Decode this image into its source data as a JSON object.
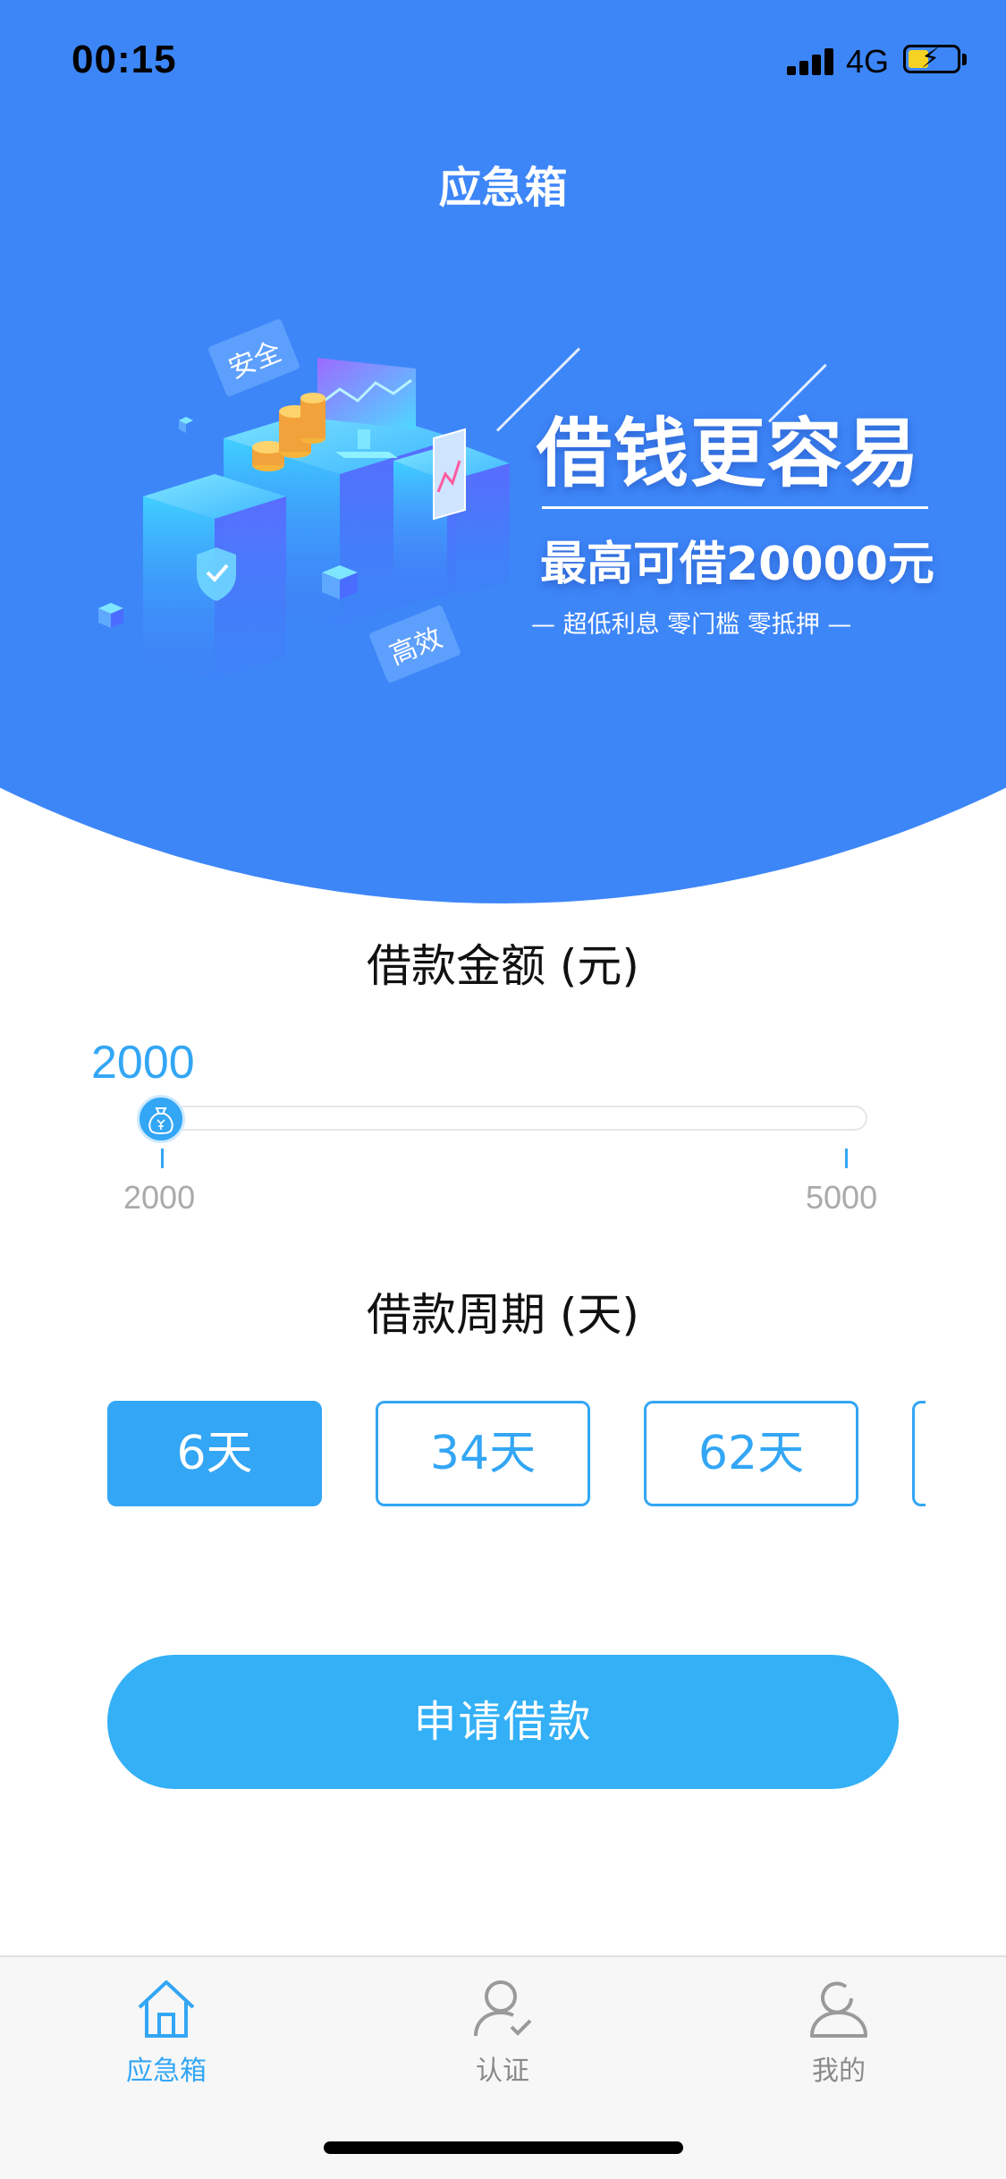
{
  "status_bar": {
    "time": "00:15",
    "network": "4G"
  },
  "header": {
    "title": "应急箱"
  },
  "banner": {
    "tag_security": "安全",
    "tag_efficiency": "高效",
    "headline": "借钱更容易",
    "subheadline": "最高可借20000元",
    "features": "— 超低利息  零门槛   零抵押 —"
  },
  "loan_amount": {
    "title": "借款金额 (元)",
    "current_value": "2000",
    "min_label": "2000",
    "max_label": "5000",
    "fill_fraction": 0
  },
  "loan_period": {
    "title": "借款周期 (天)",
    "options": [
      "6天",
      "34天",
      "62天"
    ],
    "selected": "6天"
  },
  "apply_button": {
    "label": "申请借款"
  },
  "tabbar": {
    "items": [
      {
        "label": "应急箱",
        "icon": "home-icon",
        "active": true
      },
      {
        "label": "认证",
        "icon": "verify-user-icon",
        "active": false
      },
      {
        "label": "我的",
        "icon": "profile-icon",
        "active": false
      }
    ]
  },
  "colors": {
    "hero_blue": "#3d86f8",
    "accent": "#33a6f5",
    "tab_inactive": "#8a8a8a"
  }
}
